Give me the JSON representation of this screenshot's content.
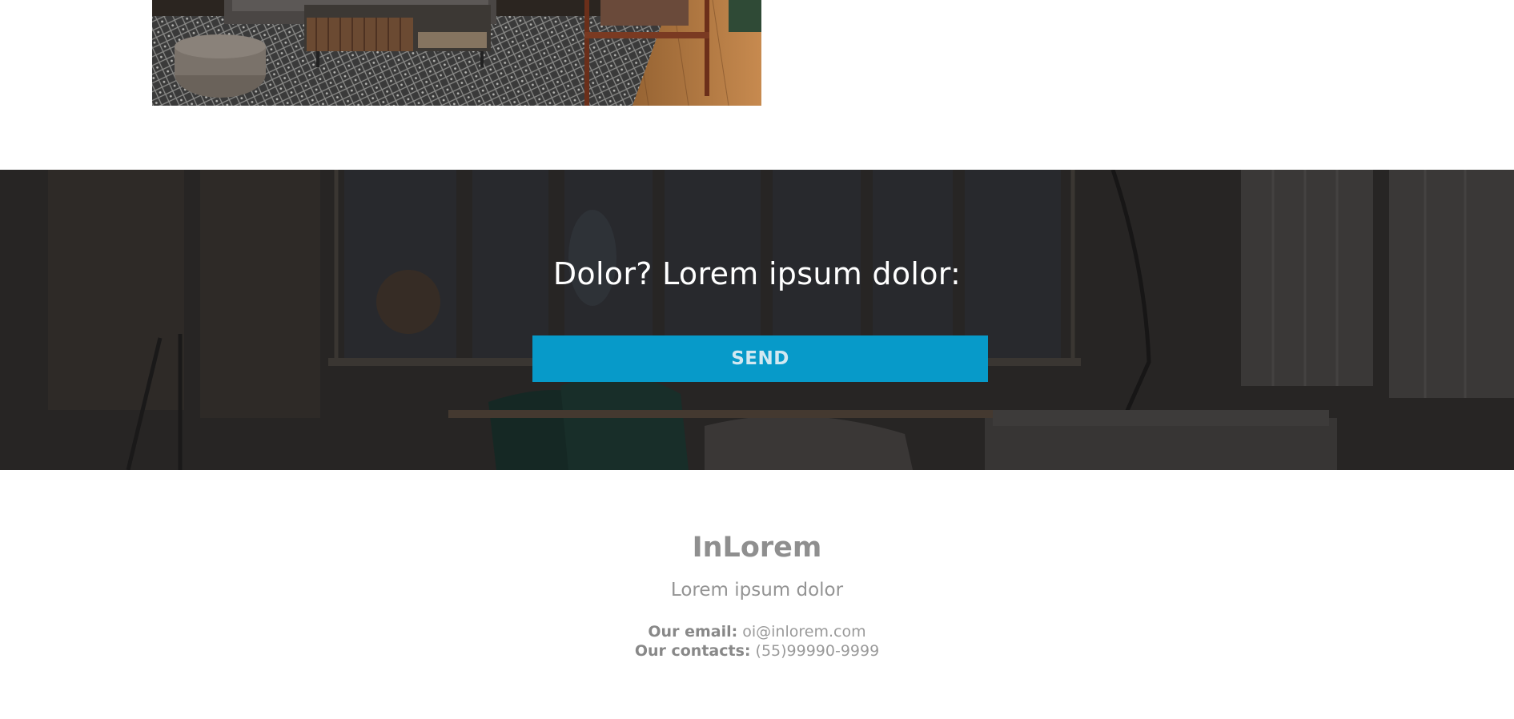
{
  "cta": {
    "title": "Dolor? Lorem ipsum dolor:",
    "button_label": "SEND"
  },
  "footer": {
    "brand": "InLorem",
    "tagline": "Lorem ipsum dolor",
    "email_label": "Our email:",
    "email_value": "oi@inlorem.com",
    "contacts_label": "Our contacts:",
    "contacts_value": "(55)99990-9999"
  },
  "colors": {
    "button_bg": "#079ac9",
    "footer_text": "#8f8f8f",
    "band_overlay": "#2c2a29"
  }
}
